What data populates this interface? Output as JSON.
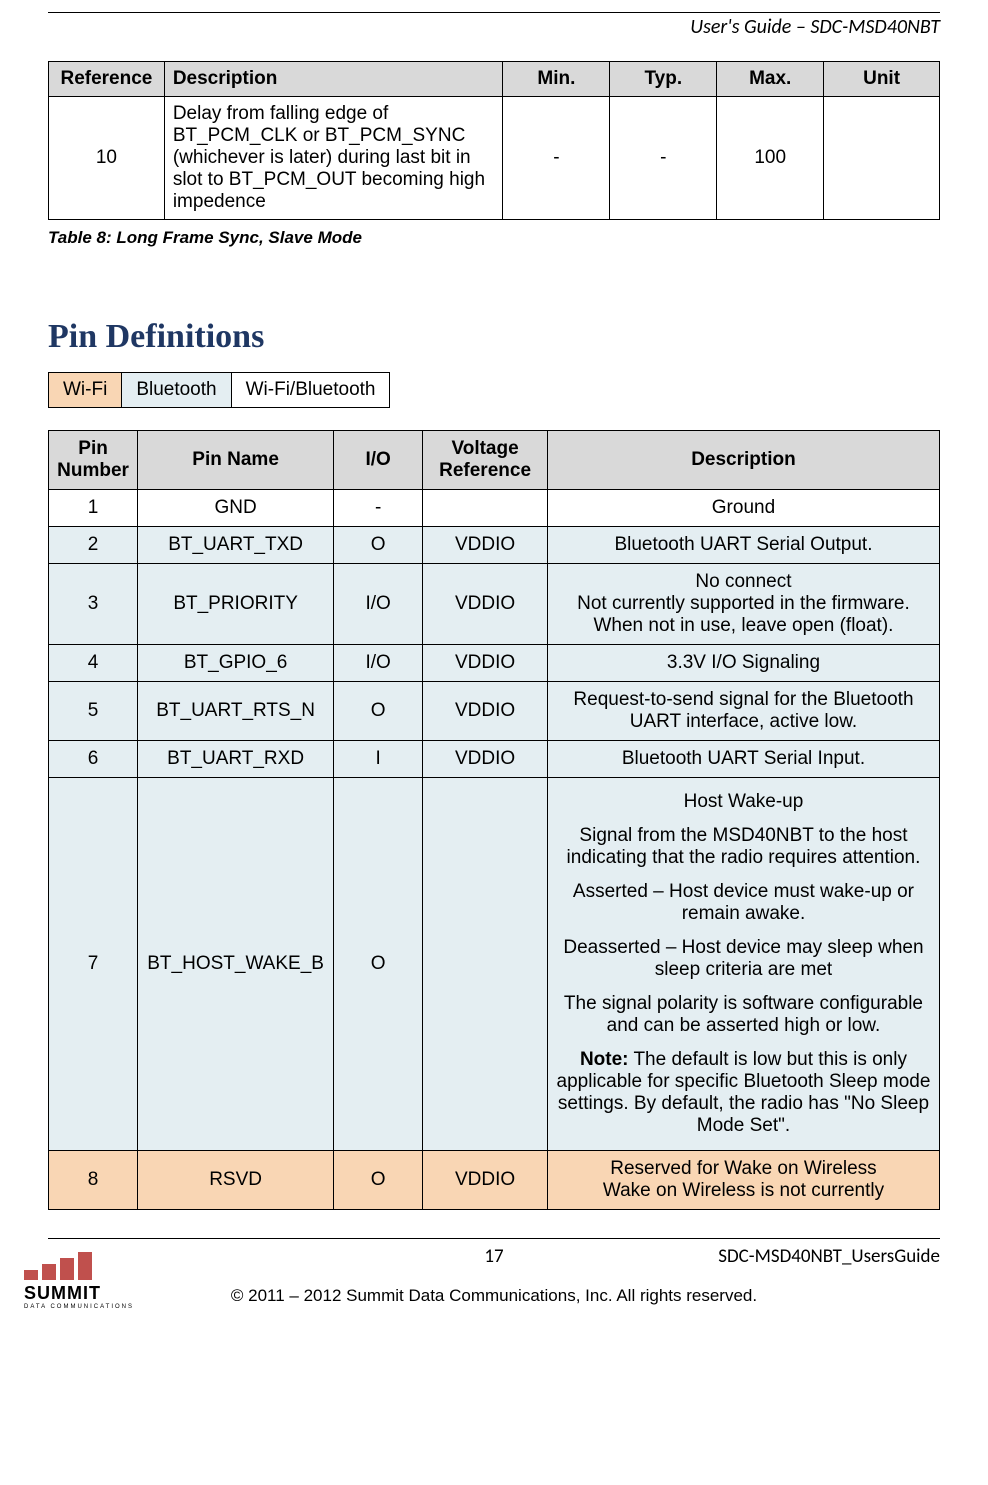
{
  "header": {
    "title": "User's Guide – SDC-MSD40NBT"
  },
  "table1": {
    "headers": {
      "ref": "Reference",
      "desc": "Description",
      "min": "Min.",
      "typ": "Typ.",
      "max": "Max.",
      "unit": "Unit"
    },
    "row": {
      "ref": "10",
      "desc": "Delay from falling edge of BT_PCM_CLK or BT_PCM_SYNC (whichever is later) during last bit in slot to BT_PCM_OUT becoming high impedence",
      "min": "-",
      "typ": "-",
      "max": "100",
      "unit": ""
    },
    "caption": "Table 8: Long Frame Sync, Slave Mode"
  },
  "pinSection": {
    "heading": "Pin Definitions",
    "legend": {
      "wifi": "Wi-Fi",
      "bt": "Bluetooth",
      "both": "Wi-Fi/Bluetooth"
    },
    "headers": {
      "num": "Pin Number",
      "name": "Pin Name",
      "io": "I/O",
      "vref": "Voltage Reference",
      "desc": "Description"
    },
    "rows": {
      "r1": {
        "num": "1",
        "name": "GND",
        "io": "-",
        "vref": "",
        "desc": "Ground"
      },
      "r2": {
        "num": "2",
        "name": "BT_UART_TXD",
        "io": "O",
        "vref": "VDDIO",
        "desc": "Bluetooth UART Serial Output."
      },
      "r3": {
        "num": "3",
        "name": "BT_PRIORITY",
        "io": "I/O",
        "vref": "VDDIO",
        "desc_l1": "No connect",
        "desc_l2": "Not currently supported in the firmware.",
        "desc_l3": "When not in use, leave open (float)."
      },
      "r4": {
        "num": "4",
        "name": "BT_GPIO_6",
        "io": "I/O",
        "vref": "VDDIO",
        "desc": "3.3V I/O Signaling"
      },
      "r5": {
        "num": "5",
        "name": "BT_UART_RTS_N",
        "io": "O",
        "vref": "VDDIO",
        "desc": "Request-to-send signal for the Bluetooth UART interface, active low."
      },
      "r6": {
        "num": "6",
        "name": "BT_UART_RXD",
        "io": "I",
        "vref": "VDDIO",
        "desc": "Bluetooth UART Serial Input."
      },
      "r7": {
        "num": "7",
        "name": "BT_HOST_WAKE_B",
        "io": "O",
        "vref": "",
        "p1": "Host Wake-up",
        "p2": "Signal from the MSD40NBT to the host indicating that the radio requires attention.",
        "p3": "Asserted – Host device must wake-up or remain awake.",
        "p4": "Deasserted – Host device may sleep when sleep criteria are met",
        "p5": "The signal polarity is software configurable and can be asserted high or low.",
        "p6a": "Note:",
        "p6b": " The default is low but this is only applicable for specific Bluetooth Sleep mode settings. By default, the radio has \"No Sleep Mode Set\"."
      },
      "r8": {
        "num": "8",
        "name": "RSVD",
        "io": "O",
        "vref": "VDDIO",
        "desc_l1": "Reserved for Wake on Wireless",
        "desc_l2": "Wake on Wireless is not currently"
      }
    }
  },
  "footer": {
    "page": "17",
    "docid": "SDC-MSD40NBT_UsersGuide",
    "copyright": "© 2011 – 2012 Summit Data Communications, Inc. All rights reserved.",
    "logo_word": "SUMMIT",
    "logo_sub": "DATA  COMMUNICATIONS"
  }
}
